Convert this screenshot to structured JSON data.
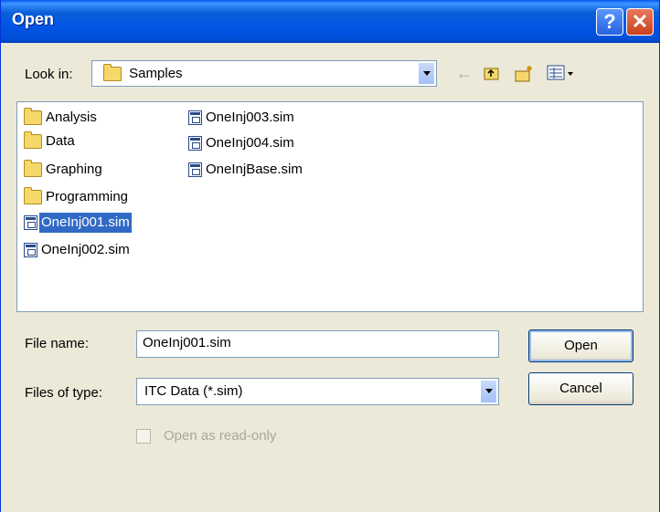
{
  "dialog": {
    "title": "Open"
  },
  "look_in": {
    "label": "Look in:",
    "value": "Samples"
  },
  "toolbar": {
    "icons": [
      "back-arrow-icon",
      "up-one-level-icon",
      "new-folder-icon",
      "view-menu-icon"
    ]
  },
  "files": {
    "items": [
      {
        "name": "Analysis",
        "type": "folder"
      },
      {
        "name": "Data",
        "type": "folder"
      },
      {
        "name": "Graphing",
        "type": "folder"
      },
      {
        "name": "Programming",
        "type": "folder"
      },
      {
        "name": "OneInj001.sim",
        "type": "file",
        "selected": true
      },
      {
        "name": "OneInj002.sim",
        "type": "file"
      },
      {
        "name": "OneInj003.sim",
        "type": "file"
      },
      {
        "name": "OneInj004.sim",
        "type": "file"
      },
      {
        "name": "OneInjBase.sim",
        "type": "file"
      }
    ]
  },
  "file_name": {
    "label": "File name:",
    "value": "OneInj001.sim"
  },
  "file_type": {
    "label": "Files of type:",
    "value": "ITC Data (*.sim)"
  },
  "buttons": {
    "open": "Open",
    "cancel": "Cancel"
  },
  "read_only": {
    "label": "Open as read-only",
    "checked": false,
    "enabled": false
  },
  "colors": {
    "selection": "#316ac5",
    "titlebar": "#0055e5",
    "dialog_bg": "#ece9d8"
  }
}
